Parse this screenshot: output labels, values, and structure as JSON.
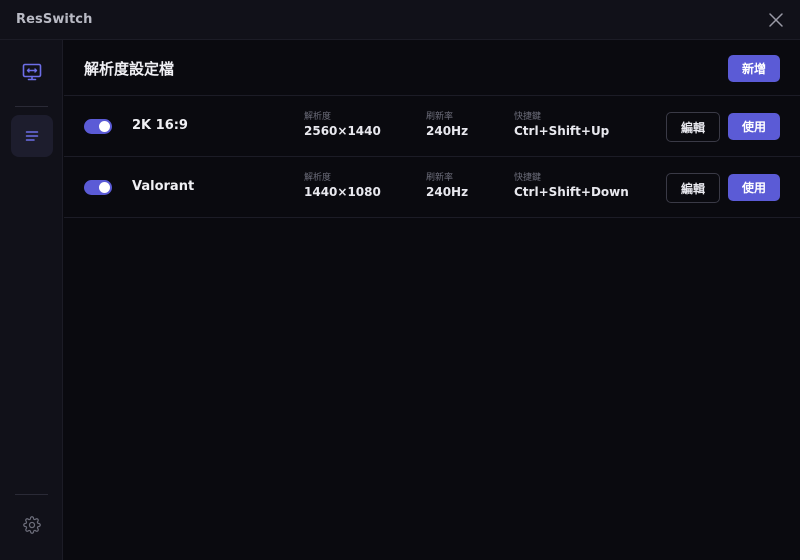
{
  "app": {
    "title": "ResSwitch"
  },
  "sidebar": {
    "items": [
      {
        "icon": "monitor-resize-icon",
        "active": false
      },
      {
        "icon": "list-icon",
        "active": true
      }
    ],
    "settings_icon": "gear-icon"
  },
  "page": {
    "title": "解析度設定檔",
    "add_label": "新增"
  },
  "columns": {
    "resolution": "解析度",
    "refresh_rate": "刷新率",
    "hotkey": "快捷鍵"
  },
  "profiles": [
    {
      "enabled": true,
      "name": "2K 16:9",
      "resolution": "2560×1440",
      "refresh_rate": "240Hz",
      "hotkey": "Ctrl+Shift+Up",
      "edit_label": "編輯",
      "use_label": "使用"
    },
    {
      "enabled": true,
      "name": "Valorant",
      "resolution": "1440×1080",
      "refresh_rate": "240Hz",
      "hotkey": "Ctrl+Shift+Down",
      "edit_label": "編輯",
      "use_label": "使用"
    }
  ],
  "colors": {
    "accent": "#5b5bd6",
    "background": "#0a0a0f",
    "panel": "#111119"
  }
}
